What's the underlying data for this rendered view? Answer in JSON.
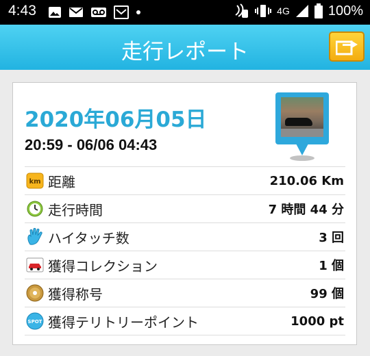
{
  "status_bar": {
    "time": "4:43",
    "left_icons": [
      "image-icon",
      "mail-icon",
      "voicemail-icon",
      "mail-box-icon",
      "dot-icon"
    ],
    "network": "4G",
    "battery_percent": "100%"
  },
  "header": {
    "title": "走行レポート",
    "share_icon": "share-arrow-icon",
    "accent": "#22b3e1"
  },
  "report": {
    "date": "2020年06月05日",
    "time_range": "20:59 - 06/06 04:43",
    "accent_color": "#2aa9d6"
  },
  "rows": [
    {
      "icon": "km-icon",
      "label": "距離",
      "value": "210.06 Km"
    },
    {
      "icon": "clock-icon",
      "label": "走行時間",
      "value": "7 時間 44 分"
    },
    {
      "icon": "hand-icon",
      "label": "ハイタッチ数",
      "value": "3 回"
    },
    {
      "icon": "car-card-icon",
      "label": "獲得コレクション",
      "value": "1 個"
    },
    {
      "icon": "medal-icon",
      "label": "獲得称号",
      "value": "99 個"
    },
    {
      "icon": "spot-icon",
      "label": "獲得テリトリーポイント",
      "value": "1000 pt"
    }
  ],
  "icon_text": {
    "km": "km",
    "spot": "SPOT"
  }
}
